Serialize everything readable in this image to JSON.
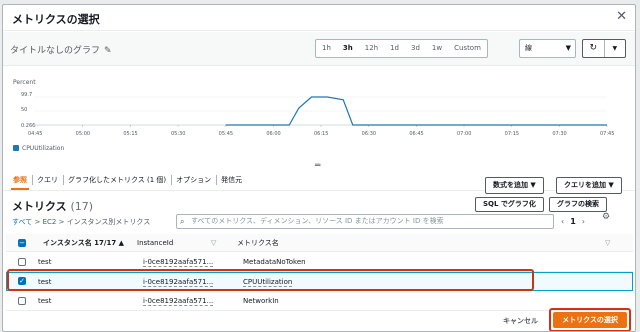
{
  "modal": {
    "title": "メトリクスの選択",
    "close": "✕"
  },
  "graph": {
    "title": "タイトルなしのグラフ",
    "edit_icon": "pencil-icon",
    "time_ranges": [
      "1h",
      "3h",
      "12h",
      "1d",
      "3d",
      "1w",
      "Custom"
    ],
    "active_range": "3h",
    "chart_type": "線",
    "refresh_icon": "↻",
    "more_icon": "▼"
  },
  "chart_data": {
    "type": "line",
    "ylabel": "Percent",
    "yticks": [
      "99.7",
      "50",
      "0.266"
    ],
    "ylim": [
      0,
      110
    ],
    "x": [
      "04:45",
      "05:00",
      "05:15",
      "05:30",
      "05:45",
      "06:00",
      "06:15",
      "06:30",
      "06:45",
      "07:00",
      "07:15",
      "07:30",
      "07:45"
    ],
    "series": [
      {
        "name": "CPUUtilization",
        "color": "#1f77b4",
        "points": [
          [
            "05:45",
            0.266
          ],
          [
            "05:50",
            0.266
          ],
          [
            "05:55",
            0.266
          ],
          [
            "06:00",
            0.266
          ],
          [
            "06:05",
            0.266
          ],
          [
            "06:08",
            60
          ],
          [
            "06:12",
            99.7
          ],
          [
            "06:17",
            99.7
          ],
          [
            "06:22",
            90
          ],
          [
            "06:25",
            0.266
          ],
          [
            "06:30",
            0.266
          ],
          [
            "06:45",
            0.266
          ],
          [
            "07:00",
            0.266
          ],
          [
            "07:15",
            0.266
          ],
          [
            "07:30",
            0.266
          ],
          [
            "07:45",
            0.266
          ]
        ]
      }
    ]
  },
  "handle": "═",
  "tabs": [
    "参照",
    "クエリ",
    "グラフ化したメトリクス (1 個)",
    "オプション",
    "発信元"
  ],
  "active_tab": "参照",
  "actions": {
    "math": "数式を追加 ▼",
    "query": "クエリを追加 ▼"
  },
  "metrics": {
    "title": "メトリクス",
    "count": "(17)",
    "sql_button": "SQL でグラフ化",
    "search_button": "グラフの検索",
    "breadcrumb": {
      "all": "すべて",
      "sep": ">",
      "ec2": "EC2",
      "current": "インスタンス別メトリクス"
    },
    "search_placeholder": "すべてのメトリクス、ディメンション、リソース ID またはアカウント ID を検索",
    "pager": {
      "prev": "‹",
      "page": "1",
      "next": "›"
    },
    "settings_icon": "⚙",
    "columns": [
      "インスタンス名 17/17 ▲",
      "InstanceId",
      "メトリクス名"
    ],
    "rows": [
      {
        "name": "test",
        "id": "i-0ce8192aafa571...",
        "metric": "MetadataNoToken",
        "checked": false
      },
      {
        "name": "test",
        "id": "i-0ce8192aafa571...",
        "metric": "CPUUtilization",
        "checked": true
      },
      {
        "name": "test",
        "id": "i-0ce8192aafa571...",
        "metric": "NetworkIn",
        "checked": false
      }
    ]
  },
  "footer": {
    "cancel": "キャンセル",
    "primary": "メトリクスの選択"
  }
}
